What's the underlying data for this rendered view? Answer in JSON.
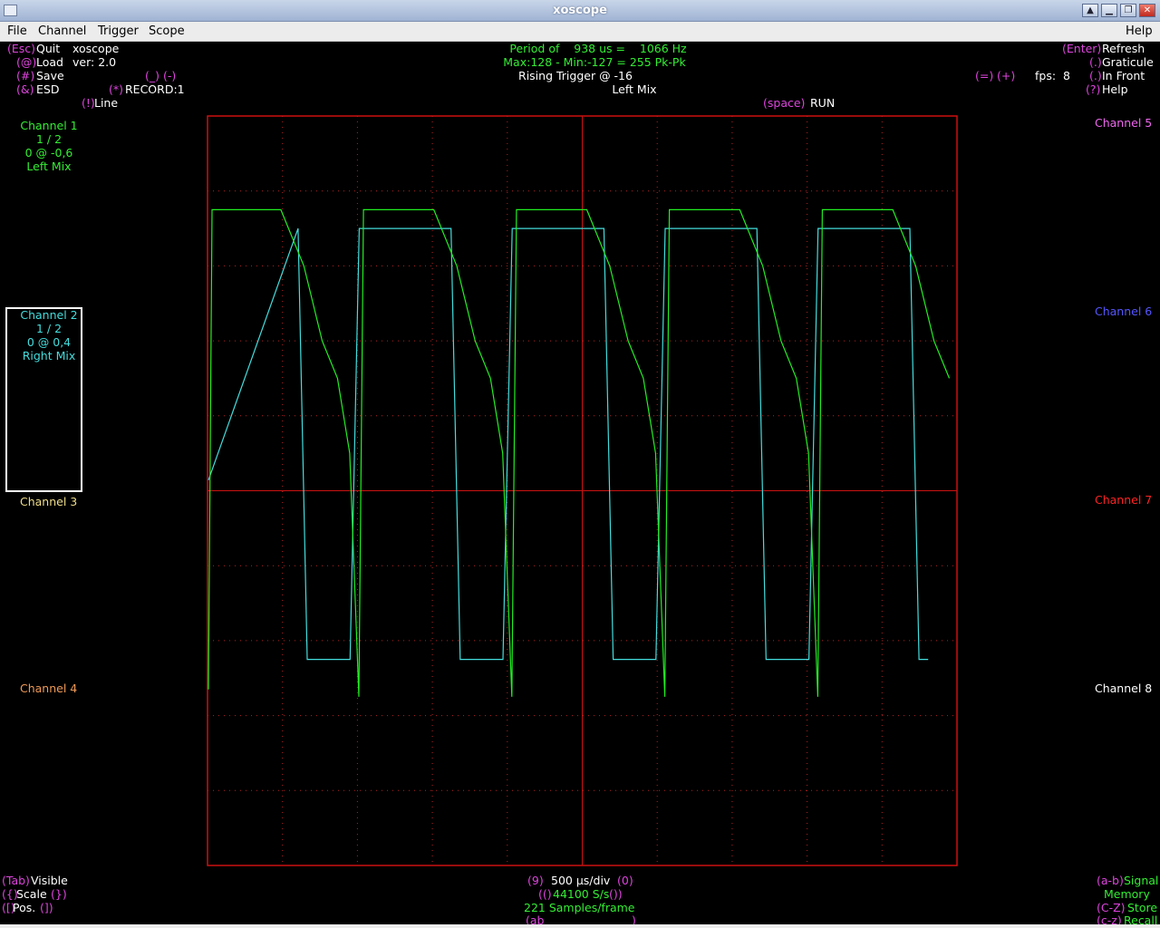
{
  "window": {
    "title": "xoscope"
  },
  "menu": {
    "file": "File",
    "channel": "Channel",
    "trigger": "Trigger",
    "scope": "Scope",
    "help": "Help"
  },
  "topleft": {
    "quit_key": "(Esc)",
    "quit_label": "Quit",
    "app_name": "xoscope",
    "load_key": "(@)",
    "load_label": "Load",
    "version": "ver: 2.0",
    "save_key": "(#)",
    "save_label": "Save",
    "underscore_key": "(_)",
    "minus_key": "(-)",
    "esd_key": "(&)",
    "esd_label": "ESD",
    "record_key": "(*)",
    "record_label": "RECORD:1",
    "line_key": "(!)",
    "line_label": "Line"
  },
  "center": {
    "period": "Period of    938 us =    1066 Hz",
    "maxmin": "Max:128 - Min:-127 = 255 Pk-Pk",
    "trigger": "Rising Trigger @ -16",
    "mix": "Left Mix",
    "run_key": "(space)",
    "run_label": "RUN"
  },
  "topright": {
    "refresh_key": "(Enter)",
    "refresh_label": "Refresh",
    "graticule_key": "(.)",
    "graticule_label": "Graticule",
    "front_key": "(.)",
    "front_label": "In Front",
    "eq_key": "(=)",
    "plus_key": "(+)",
    "fps": "fps:  8",
    "help_key": "(?)",
    "help_label": "Help"
  },
  "channels_left": {
    "ch1": {
      "name": "Channel 1",
      "scale": "1 / 2",
      "pos": "0 @ -0,6",
      "source": "Left Mix"
    },
    "ch2": {
      "name": "Channel 2",
      "scale": "1 / 2",
      "pos": "0 @ 0,4",
      "source": "Right Mix"
    },
    "ch3": {
      "name": "Channel 3"
    },
    "ch4": {
      "name": "Channel 4"
    }
  },
  "channels_right": {
    "ch5": "Channel 5",
    "ch6": "Channel 6",
    "ch7": "Channel 7",
    "ch8": "Channel 8"
  },
  "bottom": {
    "tab_key": "(Tab)",
    "visible_label": "Visible",
    "scale_open": "({)",
    "scale_label": "Scale",
    "scale_close": "(})",
    "pos_open": "([)",
    "pos_label": "Pos.",
    "pos_close": "(])",
    "nine_key": "(9)",
    "timebase": "500 µs/div",
    "zero_key": "(0)",
    "rate_open": "(()",
    "rate": "44100 S/s",
    "rate_close": "())",
    "samples": "221 Samples/frame",
    "ab_open": "(ab",
    "ab_close": ")",
    "signal_key": "(a-b)",
    "signal_label": "Signal",
    "memory_label": "Memory",
    "store_key": "(C-Z)",
    "store_label": "Store",
    "recall_key": "(c-z)",
    "recall_label": "Recall"
  },
  "colors": {
    "graticule": "#cc1111",
    "dots": "#b52222",
    "ch1": "#22ee22",
    "ch2": "#44dddd",
    "menu_key": "#dd44dd",
    "text": "#ffffff"
  },
  "chart_data": [
    {
      "type": "line",
      "series": [
        {
          "name": "Channel 2",
          "shape": "square_wave",
          "cycles": 4.9,
          "high": 0.7,
          "low": -0.45
        },
        {
          "name": "Channel 1",
          "shape": "decaying_square_with_spike",
          "cycles": 4.9,
          "high": 0.75,
          "low": -1.0
        }
      ],
      "x_divisions": 10,
      "y_divisions": 10,
      "grid": true
    }
  ]
}
